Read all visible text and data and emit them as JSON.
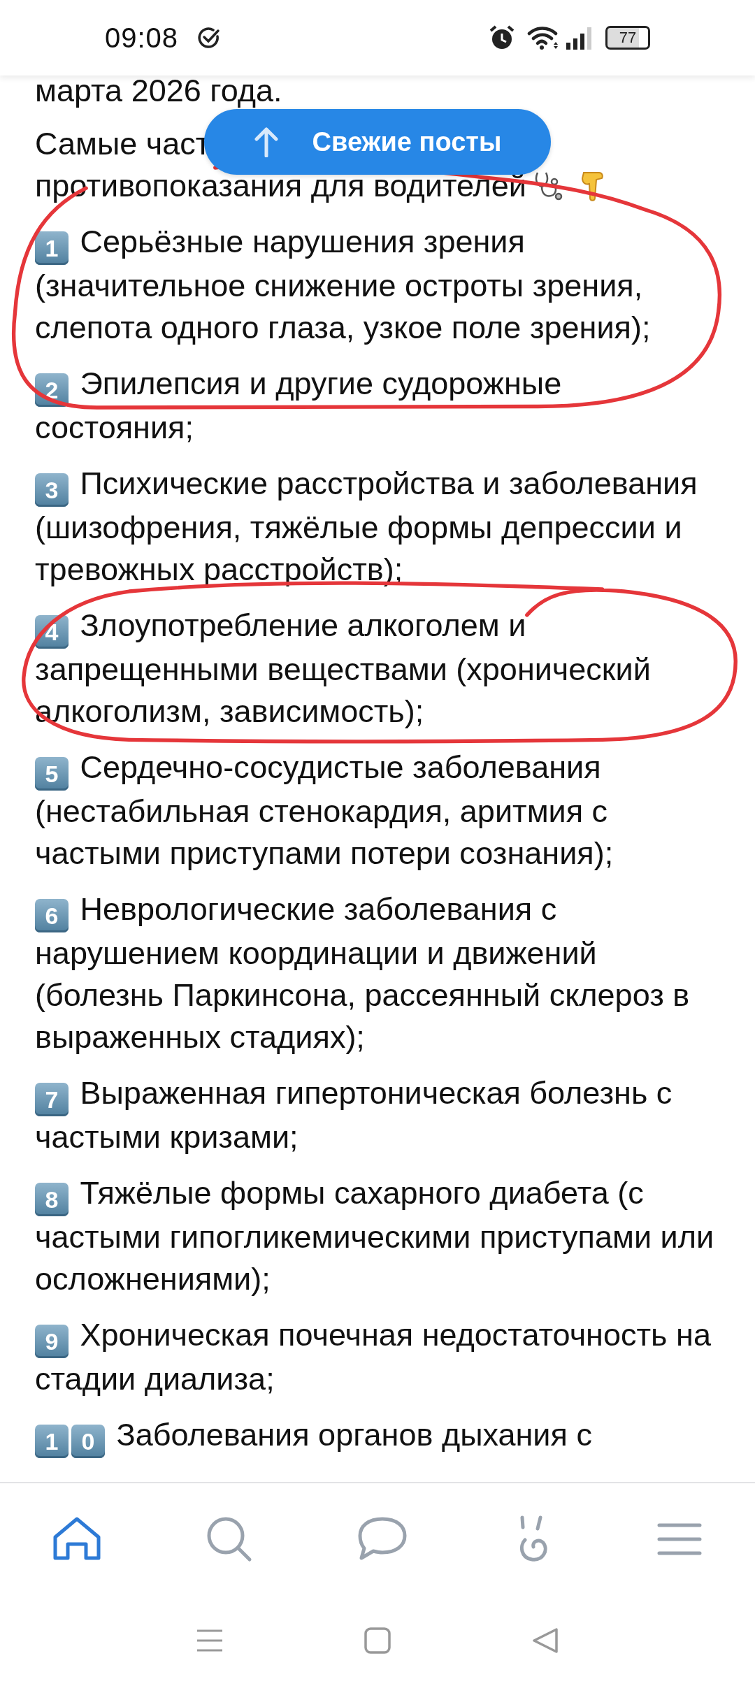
{
  "status_bar": {
    "time": "09:08",
    "battery": "77"
  },
  "fresh_posts_button": {
    "label": "Свежие посты"
  },
  "post": {
    "lead": "марта 2026 года.",
    "intro_lines": [
      "Самые част",
      "противопоказания для водителей"
    ],
    "items": [
      {
        "keycaps": [
          "1"
        ],
        "text": "Серьёзные нарушения зрения (значительное снижение остроты зрения, слепота одного глаза, узкое поле зрения);"
      },
      {
        "keycaps": [
          "2"
        ],
        "text": "Эпилепсия и другие судорожные состояния;"
      },
      {
        "keycaps": [
          "3"
        ],
        "text": "Психические расстройства и заболевания (шизофрения, тяжёлые формы депрессии и тревожных расстройств);"
      },
      {
        "keycaps": [
          "4"
        ],
        "text": "Злоупотребление алкоголем и запрещенными веществами (хронический алкоголизм, зависимость);"
      },
      {
        "keycaps": [
          "5"
        ],
        "text": "Сердечно-сосудистые заболевания (нестабильная стенокардия, аритмия с частыми приступами потери сознания);"
      },
      {
        "keycaps": [
          "6"
        ],
        "text": "Неврологические заболевания с нарушением координации и движений (болезнь Паркинсона, рассеянный склероз в выраженных стадиях);"
      },
      {
        "keycaps": [
          "7"
        ],
        "text": "Выраженная гипертоническая болезнь с частыми кризами;"
      },
      {
        "keycaps": [
          "8"
        ],
        "text": "Тяжёлые формы сахарного диабета (с частыми гипогликемическими приступами или осложнениями);"
      },
      {
        "keycaps": [
          "9"
        ],
        "text": "Хроническая почечная недостаточность на стадии диализа;"
      },
      {
        "keycaps": [
          "1",
          "0"
        ],
        "text": "Заболевания органов дыхания с"
      }
    ]
  },
  "bottom_nav": [
    {
      "selected": true
    },
    {
      "selected": false
    },
    {
      "selected": false
    },
    {
      "selected": false
    },
    {
      "selected": false
    }
  ]
}
